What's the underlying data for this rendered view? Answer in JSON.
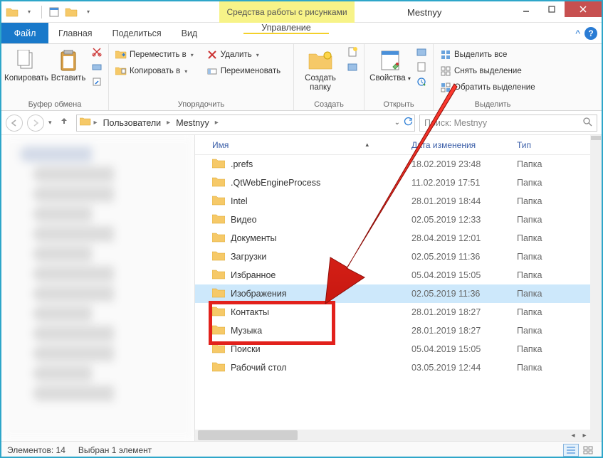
{
  "window": {
    "contextual_tab_group": "Средства работы с рисунками",
    "title": "Mestnyy"
  },
  "tabs": {
    "file": "Файл",
    "home": "Главная",
    "share": "Поделиться",
    "view": "Вид",
    "manage": "Управление"
  },
  "ribbon": {
    "clipboard": {
      "label": "Буфер обмена",
      "copy": "Копировать",
      "paste": "Вставить"
    },
    "organize": {
      "label": "Упорядочить",
      "move_to": "Переместить в",
      "copy_to": "Копировать в",
      "delete": "Удалить",
      "rename": "Переименовать"
    },
    "new": {
      "label": "Создать",
      "new_folder": "Создать папку"
    },
    "open": {
      "label": "Открыть",
      "properties": "Свойства"
    },
    "select": {
      "label": "Выделить",
      "select_all": "Выделить все",
      "select_none": "Снять выделение",
      "invert": "Обратить выделение"
    }
  },
  "breadcrumbs": {
    "users": "Пользователи",
    "current": "Mestnyy"
  },
  "search": {
    "placeholder": "Поиск: Mestnyy"
  },
  "columns": {
    "name": "Имя",
    "date": "Дата изменения",
    "type": "Тип"
  },
  "type_folder": "Папка",
  "rows": [
    {
      "name": ".prefs",
      "date": "18.02.2019 23:48"
    },
    {
      "name": ".QtWebEngineProcess",
      "date": "11.02.2019 17:51"
    },
    {
      "name": "Intel",
      "date": "28.01.2019 18:44"
    },
    {
      "name": "Видео",
      "date": "02.05.2019 12:33"
    },
    {
      "name": "Документы",
      "date": "28.04.2019 12:01"
    },
    {
      "name": "Загрузки",
      "date": "02.05.2019 11:36"
    },
    {
      "name": "Избранное",
      "date": "05.04.2019 15:05"
    },
    {
      "name": "Изображения",
      "date": "02.05.2019 11:36"
    },
    {
      "name": "Контакты",
      "date": "28.01.2019 18:27"
    },
    {
      "name": "Музыка",
      "date": "28.01.2019 18:27"
    },
    {
      "name": "Поиски",
      "date": "05.04.2019 15:05"
    },
    {
      "name": "Рабочий стол",
      "date": "03.05.2019 12:44"
    }
  ],
  "selected_row_index": 7,
  "status": {
    "items_label": "Элементов:",
    "items_count": "14",
    "selected_label": "Выбран 1 элемент"
  }
}
